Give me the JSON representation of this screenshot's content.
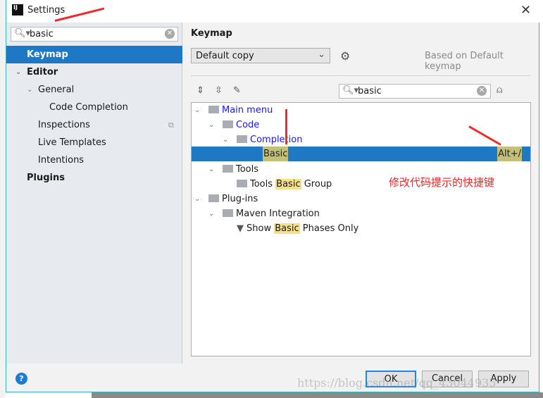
{
  "window": {
    "title": "Settings",
    "close_icon": "close-icon",
    "logo": "IJ"
  },
  "sidebar": {
    "search_value": "basic",
    "items": [
      {
        "label": "Keymap",
        "selected": true
      },
      {
        "label": "Editor"
      },
      {
        "label": "General"
      },
      {
        "label": "Code Completion"
      },
      {
        "label": "Inspections"
      },
      {
        "label": "Live Templates"
      },
      {
        "label": "Intentions"
      },
      {
        "label": "Plugins"
      }
    ]
  },
  "main": {
    "title": "Keymap",
    "keymap_select": "Default copy",
    "based_on": "Based on Default keymap",
    "search_value": "basic",
    "tree": {
      "main_menu": "Main menu",
      "code": "Code",
      "completion": "Completion",
      "basic": "Basic",
      "basic_shortcut": "Alt+/",
      "tools": "Tools",
      "tools_group_pre": "Tools",
      "tools_group_hl": "Basic",
      "tools_group_post": "Group",
      "plugins": "Plug-ins",
      "maven": "Maven Integration",
      "show_pre": "Show",
      "show_hl": "Basic",
      "show_post": "Phases Only"
    }
  },
  "annotation": "修改代码提示的快捷键",
  "footer": {
    "help": "?",
    "ok": "OK",
    "cancel": "Cancel",
    "apply": "Apply"
  },
  "watermark": "https://blog.csdn.net/qq_43044935",
  "colors": {
    "selection": "#1e78c4",
    "highlight": "#f6df8a",
    "link": "#1616ff",
    "annotation": "#e8262a"
  }
}
